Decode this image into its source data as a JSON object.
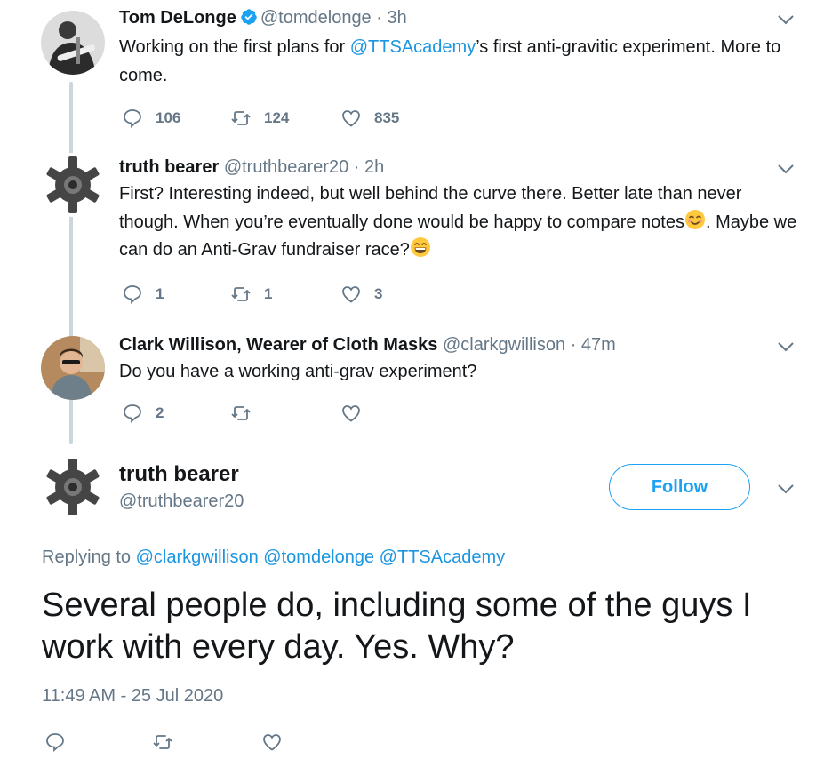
{
  "tweets": [
    {
      "name": "Tom DeLonge",
      "handle": "@tomdelonge",
      "time": "3h",
      "text_before": "Working on the first plans for ",
      "mention": "@TTSAcademy",
      "text_after": "’s first anti-gravitic experiment. More to come.",
      "replies": "106",
      "retweets": "124",
      "likes": "835"
    },
    {
      "name": "truth bearer",
      "handle": "@truthbearer20",
      "time": "2h",
      "text_1": "First? Interesting indeed, but well behind the curve there. Better late than never though. When you’re eventually done would be happy to compare notes",
      "text_2": ". Maybe we can do an Anti-Grav fundraiser race?",
      "replies": "1",
      "retweets": "1",
      "likes": "3"
    },
    {
      "name": "Clark Willison, Wearer of Cloth Masks",
      "handle": "@clarkgwillison",
      "time": "47m",
      "text": "Do you have a working anti-grav experiment?",
      "replies": "2",
      "retweets": "",
      "likes": ""
    }
  ],
  "main_tweet": {
    "name": "truth bearer",
    "handle": "@truthbearer20",
    "follow_label": "Follow",
    "replying_prefix": "Replying to",
    "replying_mentions": "@clarkgwillison @tomdelonge @TTSAcademy",
    "text": "Several people do, including some of the guys I work with every day. Yes. Why?",
    "timestamp": "11:49 AM - 25 Jul 2020"
  },
  "header_separator": "·",
  "colors": {
    "link": "#1b95e0",
    "accent": "#1da1f2",
    "muted": "#657786",
    "thread_line": "#ccd6dd"
  }
}
